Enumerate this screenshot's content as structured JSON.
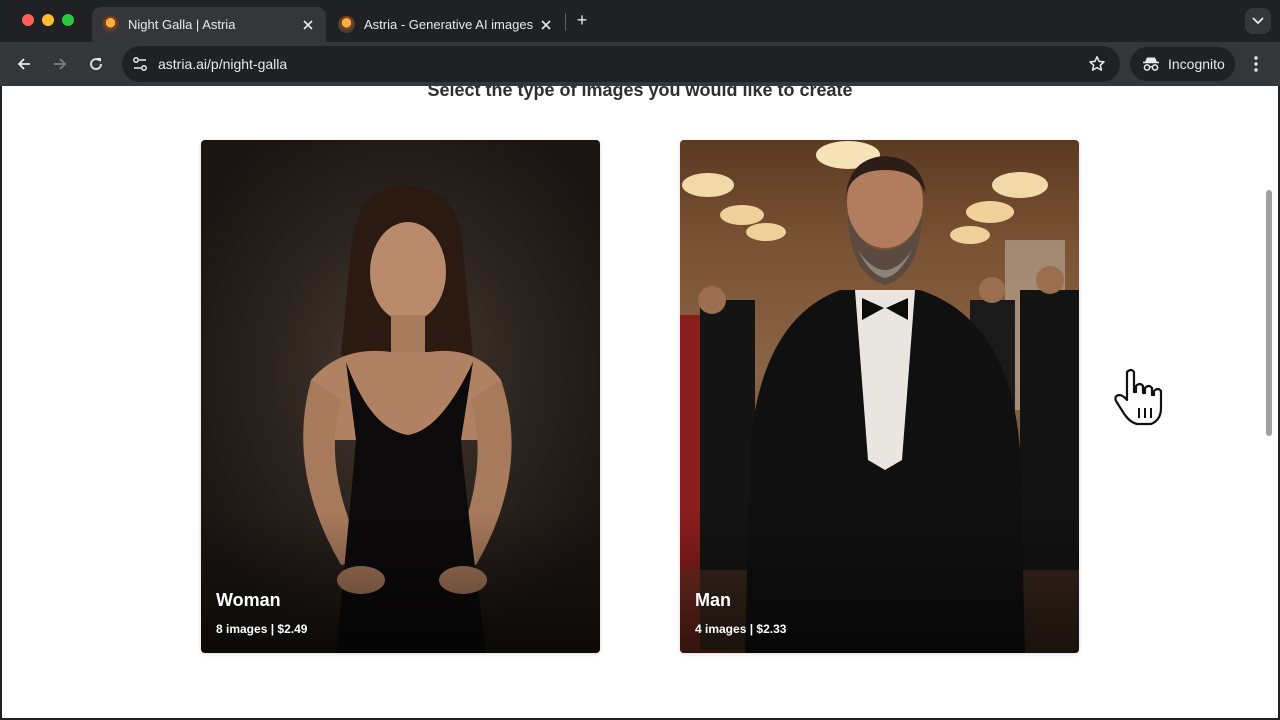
{
  "browser": {
    "tabs": [
      {
        "title": "Night Galla | Astria",
        "active": true
      },
      {
        "title": "Astria - Generative AI images",
        "active": false
      }
    ],
    "url": "astria.ai/p/night-galla",
    "incognito_label": "Incognito"
  },
  "page": {
    "heading": "Select the type of images you would like to create",
    "cards": [
      {
        "label": "Woman",
        "meta": "8 images | $2.49"
      },
      {
        "label": "Man",
        "meta": "4 images | $2.33"
      }
    ]
  },
  "icons": {
    "back": "back-arrow-icon",
    "forward": "forward-arrow-icon",
    "reload": "reload-icon",
    "site_settings": "tune-icon",
    "bookmark": "star-icon",
    "incognito": "incognito-icon",
    "menu": "three-dots-icon",
    "cursor": "hand-pointer-icon"
  }
}
